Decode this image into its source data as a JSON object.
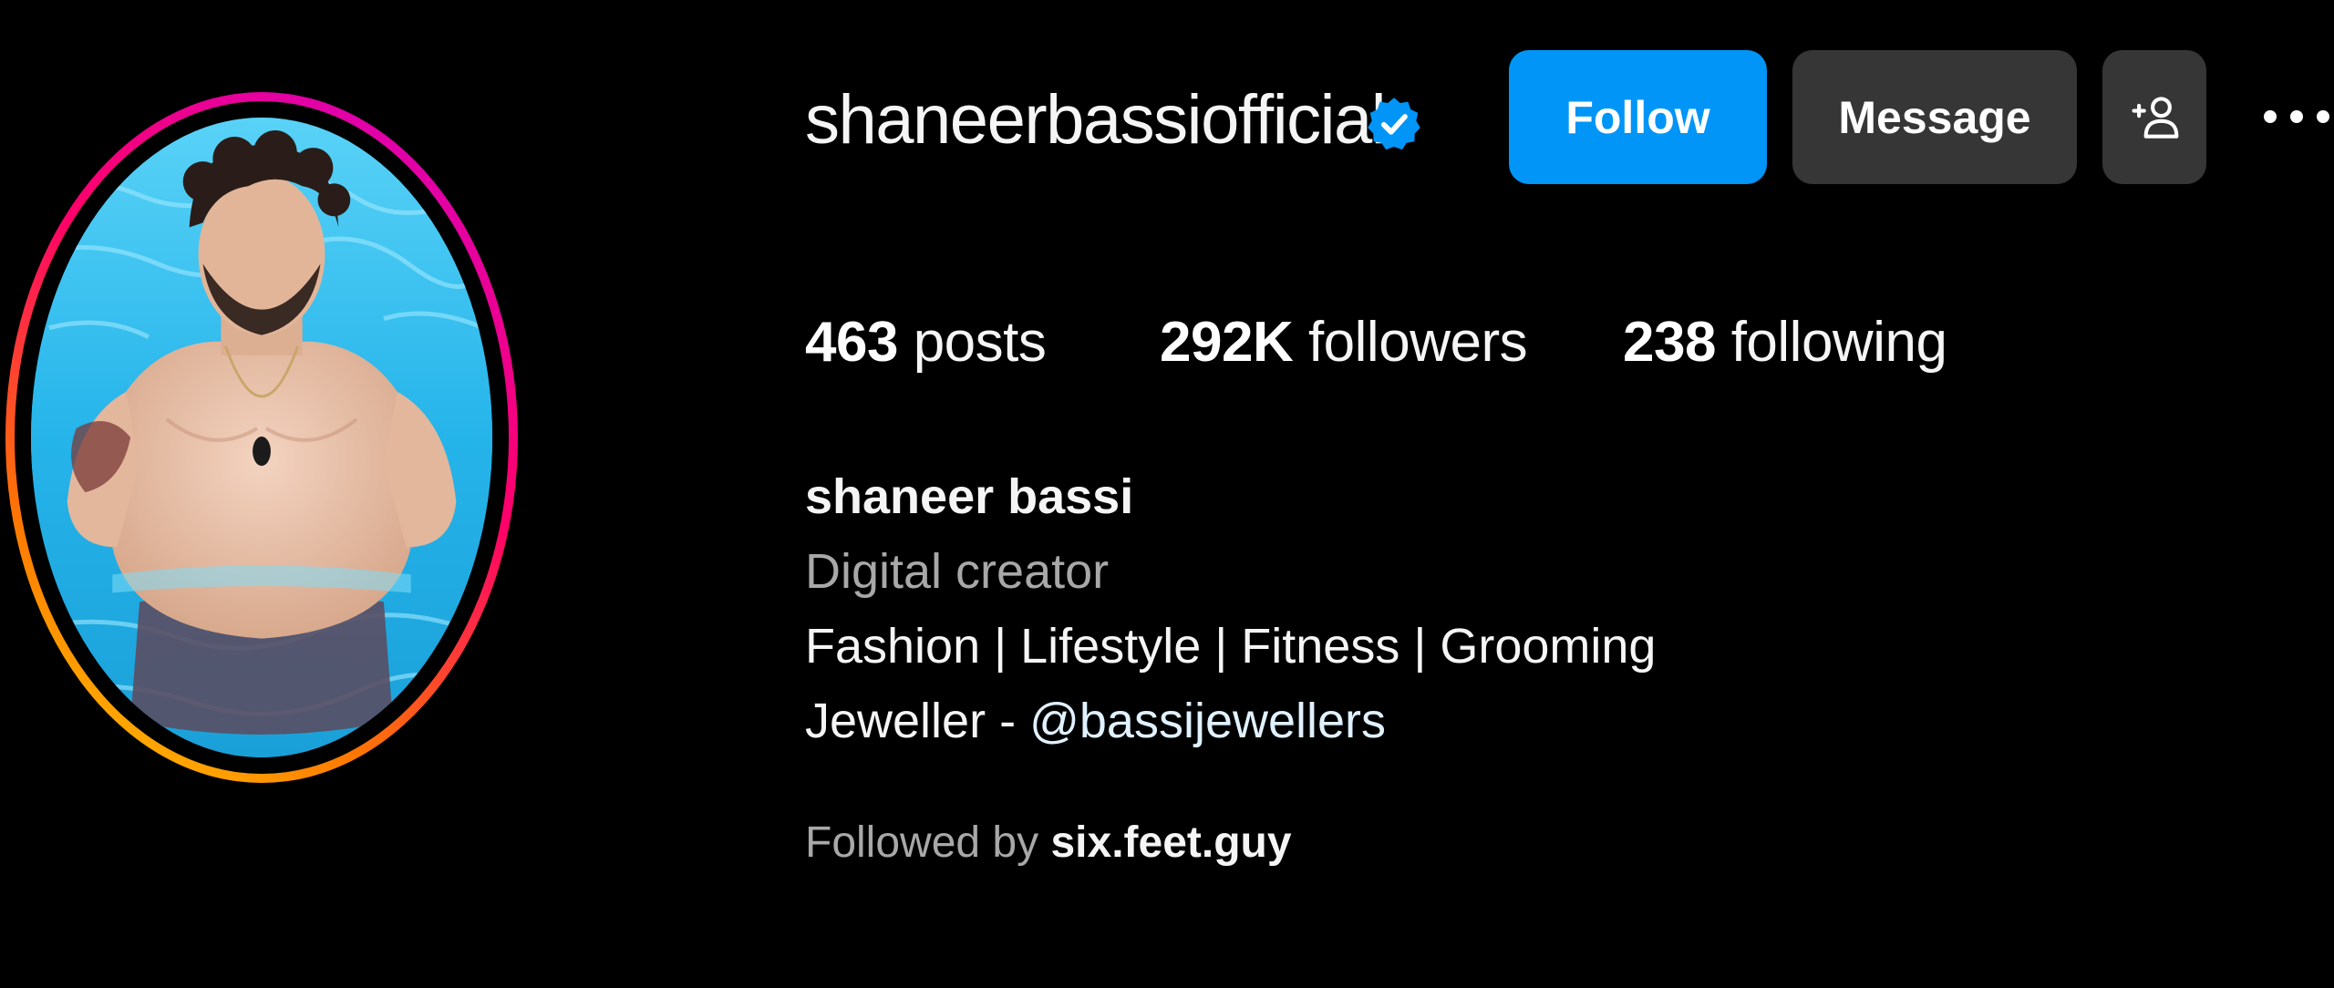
{
  "profile": {
    "username": "shaneerbassiofficial",
    "verified": true,
    "verified_icon": "verified-badge-icon",
    "avatar_alt": "profile photo in swimming pool",
    "story_ring_colors": [
      "#d300c5",
      "#ff0069",
      "#ff7a00",
      "#ffd600"
    ]
  },
  "actions": {
    "follow_label": "Follow",
    "message_label": "Message",
    "suggest_icon": "add-person-icon",
    "more_icon": "more-options-icon",
    "follow_color": "#0095f6",
    "secondary_color": "#363636"
  },
  "stats": {
    "posts_count": "463",
    "posts_label": "posts",
    "followers_count": "292K",
    "followers_label": "followers",
    "following_count": "238",
    "following_label": "following"
  },
  "bio": {
    "full_name": "shaneer bassi",
    "category": "Digital creator",
    "line1": "Fashion | Lifestyle | Fitness | Grooming",
    "line2_prefix": "Jeweller - ",
    "line2_mention": "@bassijewellers",
    "mention_color": "#e0f1ff"
  },
  "followed_by": {
    "prefix": "Followed by ",
    "name": "six.feet.guy"
  }
}
